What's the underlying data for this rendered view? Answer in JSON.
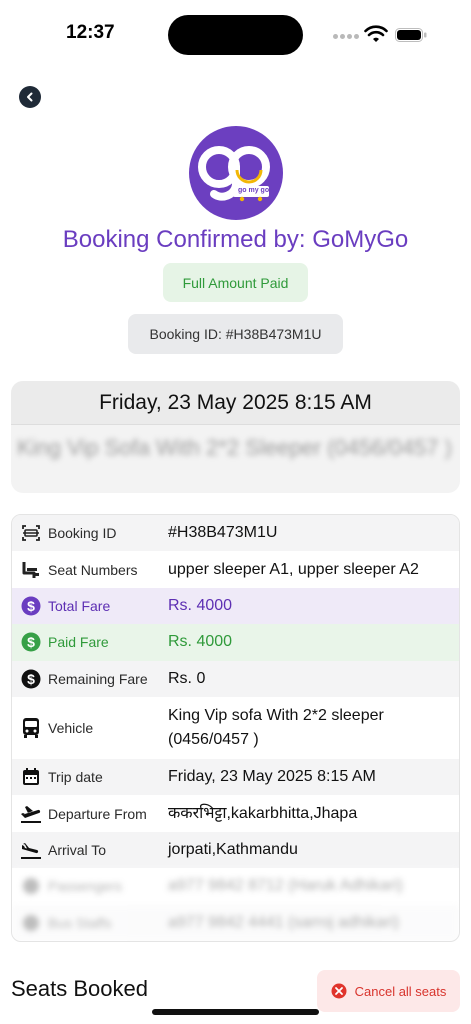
{
  "status_bar": {
    "time": "12:37"
  },
  "header": {
    "logo_text": "go my go",
    "title": "Booking Confirmed by: GoMyGo",
    "paid_badge": "Full Amount Paid",
    "booking_id_pill": "Booking ID: #H38B473M1U"
  },
  "trip_card": {
    "date_time": "Friday, 23 May 2025 8:15 AM",
    "vehicle_blurred": "King Vip Sofa With 2*2 Sleeper (0456/0457 )"
  },
  "details": [
    {
      "icon": "barcode-icon",
      "label": "Booking ID",
      "value": "#H38B473M1U"
    },
    {
      "icon": "seat-icon",
      "label": "Seat Numbers",
      "value": "upper sleeper A1, upper sleeper A2"
    },
    {
      "icon": "dollar-icon",
      "label": "Total Fare",
      "value": "Rs. 4000"
    },
    {
      "icon": "dollar-icon",
      "label": "Paid Fare",
      "value": "Rs. 4000"
    },
    {
      "icon": "dollar-icon",
      "label": "Remaining Fare",
      "value": "Rs. 0"
    },
    {
      "icon": "bus-icon",
      "label": "Vehicle",
      "value": "King Vip sofa With 2*2 sleeper (0456/0457 )"
    },
    {
      "icon": "calendar-icon",
      "label": "Trip date",
      "value": "Friday, 23 May 2025 8:15 AM"
    },
    {
      "icon": "takeoff-icon",
      "label": "Departure From",
      "value": "ककरभिट्टा,kakarbhitta,Jhapa"
    },
    {
      "icon": "landing-icon",
      "label": "Arrival To",
      "value": "jorpati,Kathmandu"
    },
    {
      "icon": "user-icon",
      "label": "Passengers",
      "value": "a977 9842 8712 (Haruk Adhikari)"
    },
    {
      "icon": "user-icon",
      "label": "Bus Staffs",
      "value": "a977 9842 4441 (sarroj adhikari)"
    }
  ],
  "seats_section": {
    "title": "Seats Booked",
    "cancel_label": "Cancel all seats"
  },
  "colors": {
    "brand_purple": "#6a3dc0",
    "paid_green": "#2f9a3a",
    "cancel_red": "#d8342d"
  }
}
